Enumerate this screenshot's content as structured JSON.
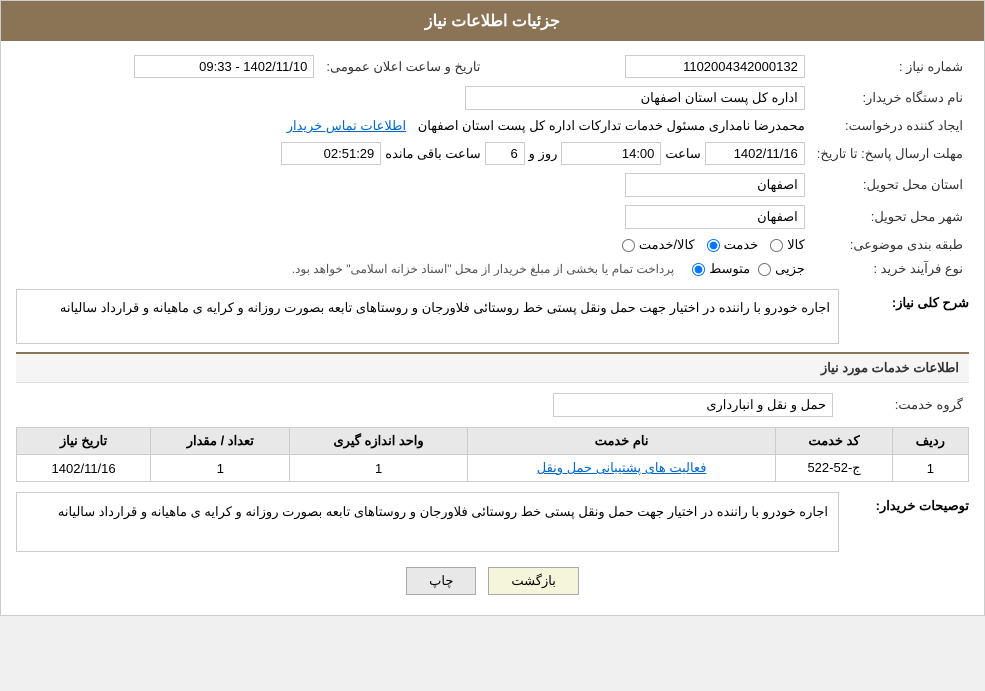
{
  "header": {
    "title": "جزئیات اطلاعات نیاز"
  },
  "fields": {
    "need_number_label": "شماره نیاز :",
    "need_number_value": "1102004342000132",
    "buyer_label": "نام دستگاه خریدار:",
    "buyer_value": "اداره کل پست استان اصفهان",
    "announcement_date_label": "تاریخ و ساعت اعلان عمومی:",
    "announcement_date_value": "1402/11/10 - 09:33",
    "creator_label": "ایجاد کننده درخواست:",
    "creator_value": "محمدرضا نامداری مسئول خدمات تداركات اداره کل پست استان اصفهان",
    "contact_link": "اطلاعات تماس خریدار",
    "deadline_label": "مهلت ارسال پاسخ: تا تاریخ:",
    "deadline_date": "1402/11/16",
    "deadline_time_label": "ساعت",
    "deadline_time": "14:00",
    "deadline_days_label": "روز و",
    "deadline_days": "6",
    "deadline_remaining_label": "ساعت باقی مانده",
    "deadline_remaining": "02:51:29",
    "province_label": "استان محل تحویل:",
    "province_value": "اصفهان",
    "city_label": "شهر محل تحویل:",
    "city_value": "اصفهان",
    "category_label": "طبقه بندی موضوعی:",
    "category_options": [
      {
        "label": "کالا",
        "value": "kala"
      },
      {
        "label": "خدمت",
        "value": "khedmat",
        "selected": true
      },
      {
        "label": "کالا/خدمت",
        "value": "kala_khedmat"
      }
    ],
    "purchase_type_label": "نوع فرآیند خرید :",
    "purchase_type_options": [
      {
        "label": "جزیی",
        "value": "jozi"
      },
      {
        "label": "متوسط",
        "value": "motavasset",
        "selected": true
      }
    ],
    "purchase_type_note": "پرداخت تمام یا بخشی از مبلغ خریدار از محل \"اسناد خزانه اسلامی\" خواهد بود."
  },
  "description": {
    "section_title": "شرح کلی نیاز:",
    "text": "اجاره خودرو با راننده در اختیار جهت حمل ونقل پستی خط روستائی فلاورجان و روستاهای تابعه بصورت روزانه و کرایه ی ماهیانه و قرارداد سالیانه"
  },
  "services": {
    "section_title": "اطلاعات خدمات مورد نیاز",
    "service_group_label": "گروه خدمت:",
    "service_group_value": "حمل و نقل و انبارداری",
    "table": {
      "headers": [
        "ردیف",
        "کد خدمت",
        "نام خدمت",
        "واحد اندازه گیری",
        "تعداد / مقدار",
        "تاریخ نیاز"
      ],
      "rows": [
        {
          "row_num": "1",
          "code": "ج-52-522",
          "name": "فعالیت های پشتیبانی حمل ونقل",
          "unit": "1",
          "quantity": "1",
          "date": "1402/11/16"
        }
      ]
    }
  },
  "buyer_notes": {
    "section_label": "توصیحات خریدار:",
    "text": "اجاره خودرو با راننده در اختیار جهت حمل ونقل پستی خط روستائی فلاورجان و روستاهای تابعه بصورت روزانه و کرایه ی ماهیانه و قرارداد سالیانه"
  },
  "buttons": {
    "back": "بازگشت",
    "print": "چاپ"
  }
}
